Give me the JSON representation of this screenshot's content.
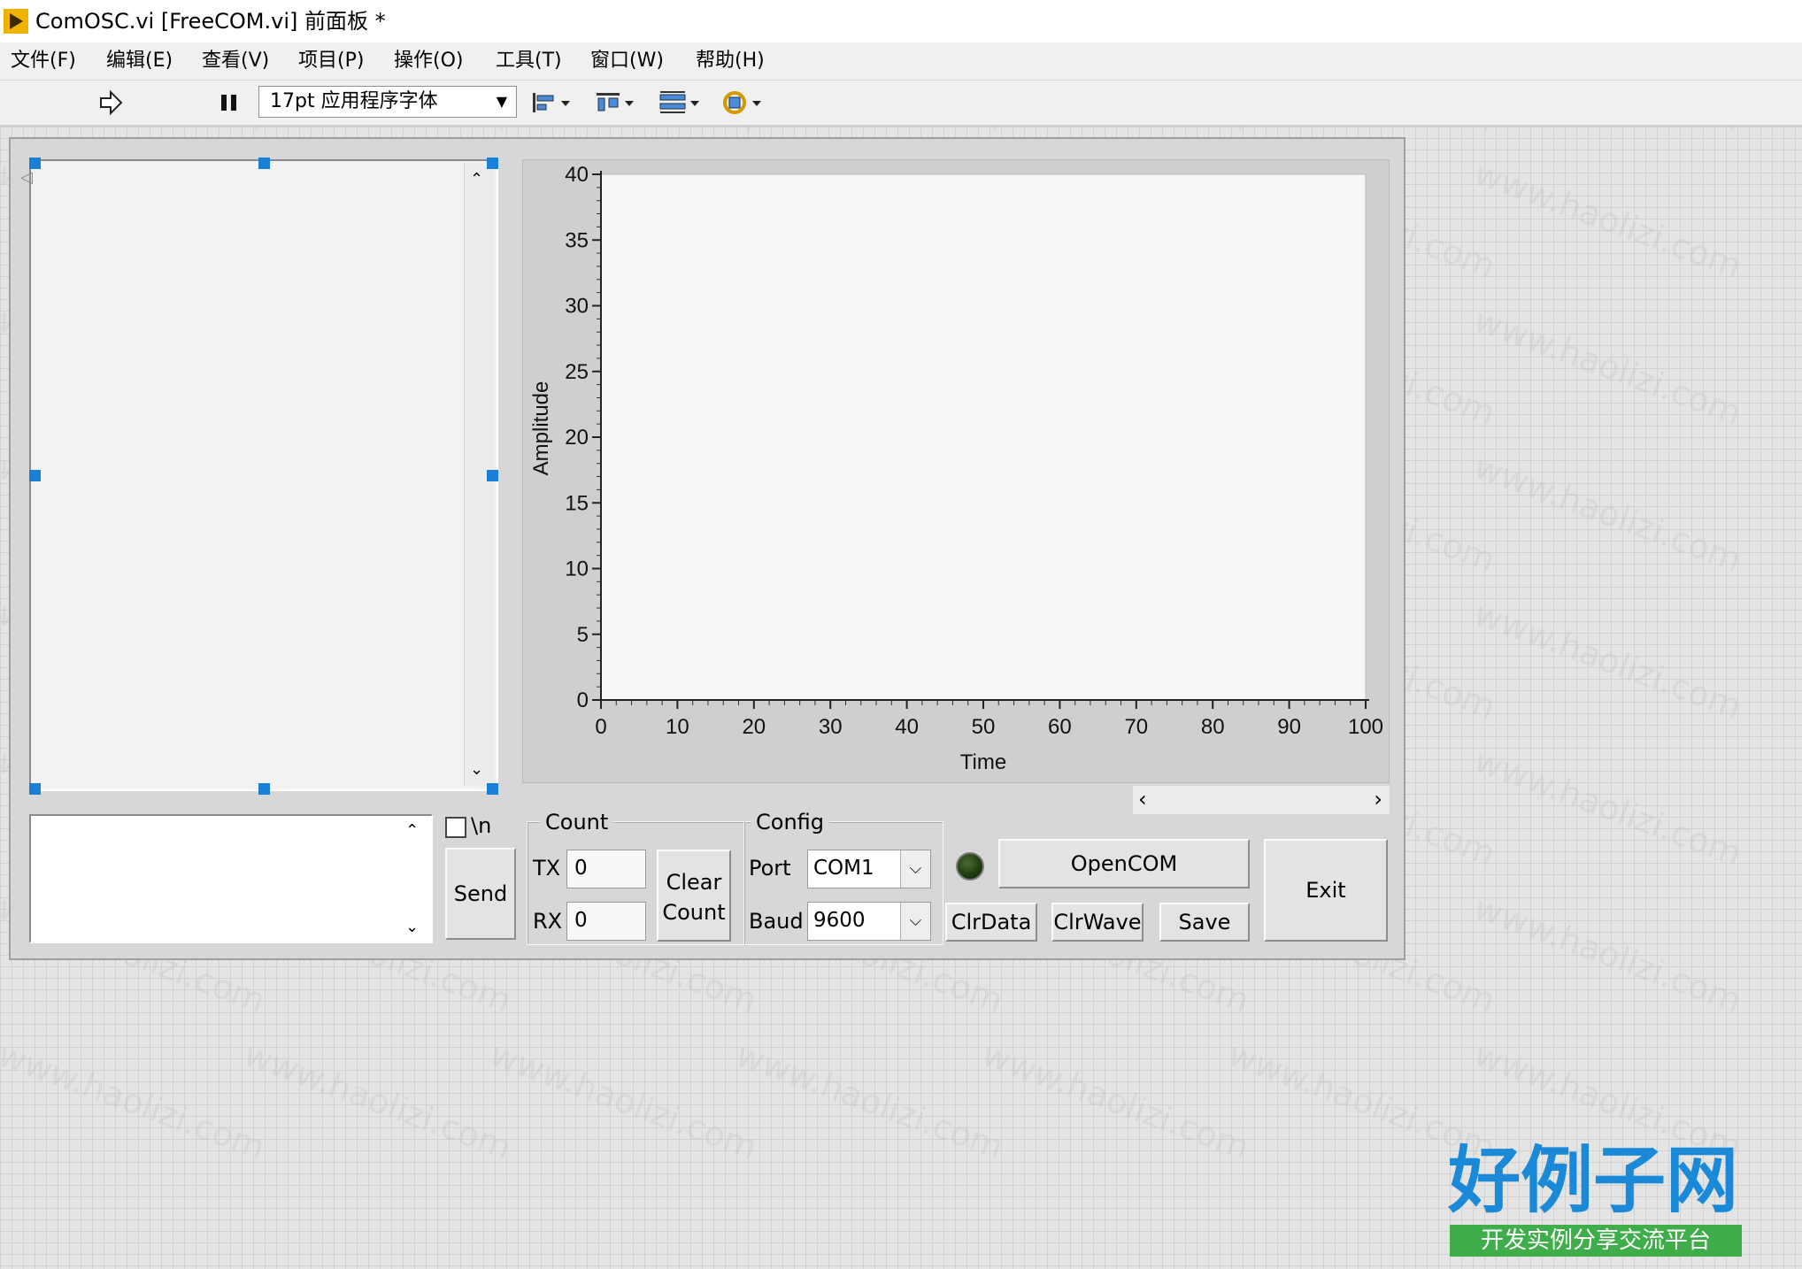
{
  "window": {
    "title": "ComOSC.vi [FreeCOM.vi] 前面板 *"
  },
  "menu": [
    "文件(F)",
    "编辑(E)",
    "查看(V)",
    "项目(P)",
    "操作(O)",
    "工具(T)",
    "窗口(W)",
    "帮助(H)"
  ],
  "toolbar": {
    "font": "17pt 应用程序字体"
  },
  "send_area": {
    "newline_label": "\\n",
    "send_button": "Send"
  },
  "count": {
    "group_label": "Count",
    "tx_label": "TX",
    "tx_value": "0",
    "rx_label": "RX",
    "rx_value": "0",
    "clear_line1": "Clear",
    "clear_line2": "Count"
  },
  "config": {
    "group_label": "Config",
    "port_label": "Port",
    "port_value": "COM1",
    "baud_label": "Baud",
    "baud_value": "9600"
  },
  "buttons": {
    "open": "OpenCOM",
    "clr_data": "ClrData",
    "clr_wave": "ClrWave",
    "save": "Save",
    "exit": "Exit"
  },
  "indicator": {
    "state": "off",
    "color": "#1e3a12"
  },
  "chart_data": {
    "type": "line",
    "xlabel": "Time",
    "ylabel": "Amplitude",
    "xlim": [
      0,
      100
    ],
    "ylim": [
      0,
      40
    ],
    "x_ticks": [
      "0",
      "10",
      "20",
      "30",
      "40",
      "50",
      "60",
      "70",
      "80",
      "90",
      "100"
    ],
    "y_ticks": [
      "0",
      "5",
      "10",
      "15",
      "20",
      "25",
      "30",
      "35",
      "40"
    ],
    "series": []
  },
  "watermark": {
    "text": "www.haolizi.com",
    "logo": "好例子网",
    "logo_sub": "开发实例分享交流平台"
  }
}
